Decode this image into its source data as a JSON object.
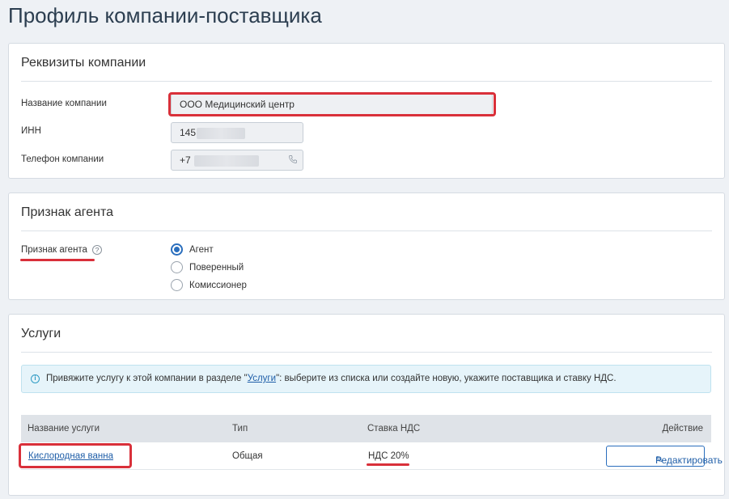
{
  "page": {
    "title": "Профиль компании-поставщика"
  },
  "company_details": {
    "title": "Реквизиты компании",
    "fields": {
      "name": {
        "label": "Название компании",
        "value": "ООО Медицинский центр"
      },
      "inn": {
        "label": "ИНН",
        "value": "145"
      },
      "phone": {
        "label": "Телефон компании",
        "value": "+7"
      }
    }
  },
  "agent": {
    "title": "Признак агента",
    "label": "Признак агента",
    "help_icon": "?",
    "options": [
      {
        "label": "Агент",
        "checked": true
      },
      {
        "label": "Поверенный",
        "checked": false
      },
      {
        "label": "Комиссионер",
        "checked": false
      }
    ]
  },
  "services": {
    "title": "Услуги",
    "info": {
      "icon": "i",
      "prefix": "Привяжите услугу к этой компании в разделе \"",
      "link": "Услуги",
      "suffix": "\": выберите из списка или создайте новую, укажите поставщика и ставку НДС."
    },
    "table": {
      "headers": {
        "name": "Название услуги",
        "type": "Тип",
        "vat": "Ставка НДС",
        "action": "Действие"
      },
      "rows": [
        {
          "name": "Кислородная ванна",
          "type": "Общая",
          "vat": "НДС 20%",
          "action": "Редактировать"
        }
      ]
    }
  },
  "colors": {
    "highlight": "#d9303a",
    "accent": "#2a6ebd",
    "link": "#1f5ea8"
  }
}
